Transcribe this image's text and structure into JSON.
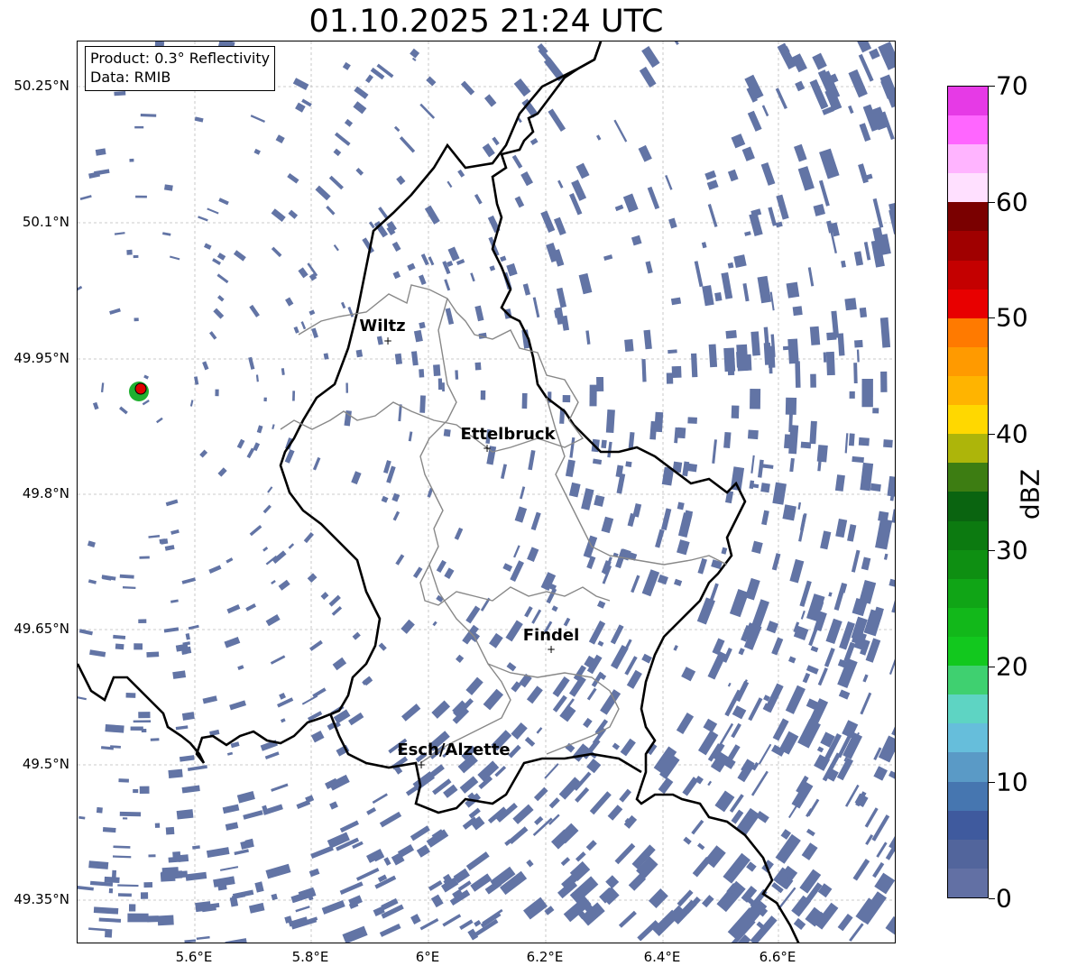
{
  "title": "01.10.2025 21:24 UTC",
  "info": {
    "line1": "Product: 0.3° Reflectivity",
    "line2": "Data: RMIB"
  },
  "axes": {
    "lat_ticks": [
      "50.25°N",
      "50.1°N",
      "49.95°N",
      "49.8°N",
      "49.65°N",
      "49.5°N",
      "49.35°N"
    ],
    "lon_ticks": [
      "5.6°E",
      "5.8°E",
      "6°E",
      "6.2°E",
      "6.4°E",
      "6.6°E"
    ]
  },
  "cities": [
    {
      "name": "Wiltz"
    },
    {
      "name": "Ettelbruck"
    },
    {
      "name": "Findel"
    },
    {
      "name": "Esch/Alzette"
    }
  ],
  "colorbar": {
    "label": "dBZ",
    "ticks": [
      "0",
      "10",
      "20",
      "30",
      "40",
      "50",
      "60",
      "70"
    ],
    "min": 0,
    "max": 70,
    "step": 2.5,
    "colors": [
      "#6270a4",
      "#52659c",
      "#3f5a9e",
      "#4676b0",
      "#5a9ac6",
      "#66bedb",
      "#5ed4c3",
      "#3fd070",
      "#12c81e",
      "#12b81a",
      "#10a516",
      "#0e8f12",
      "#0c7a10",
      "#0a6410",
      "#3d7d12",
      "#adb50a",
      "#ffd800",
      "#ffb400",
      "#ff9a00",
      "#ff7a00",
      "#e80000",
      "#c40000",
      "#a00000",
      "#7a0000",
      "#ffe0ff",
      "#ffb4ff",
      "#ff66ff",
      "#e63ae6"
    ]
  },
  "echo_color": "#6274a5",
  "radar_site": {
    "color": "#e00000"
  }
}
